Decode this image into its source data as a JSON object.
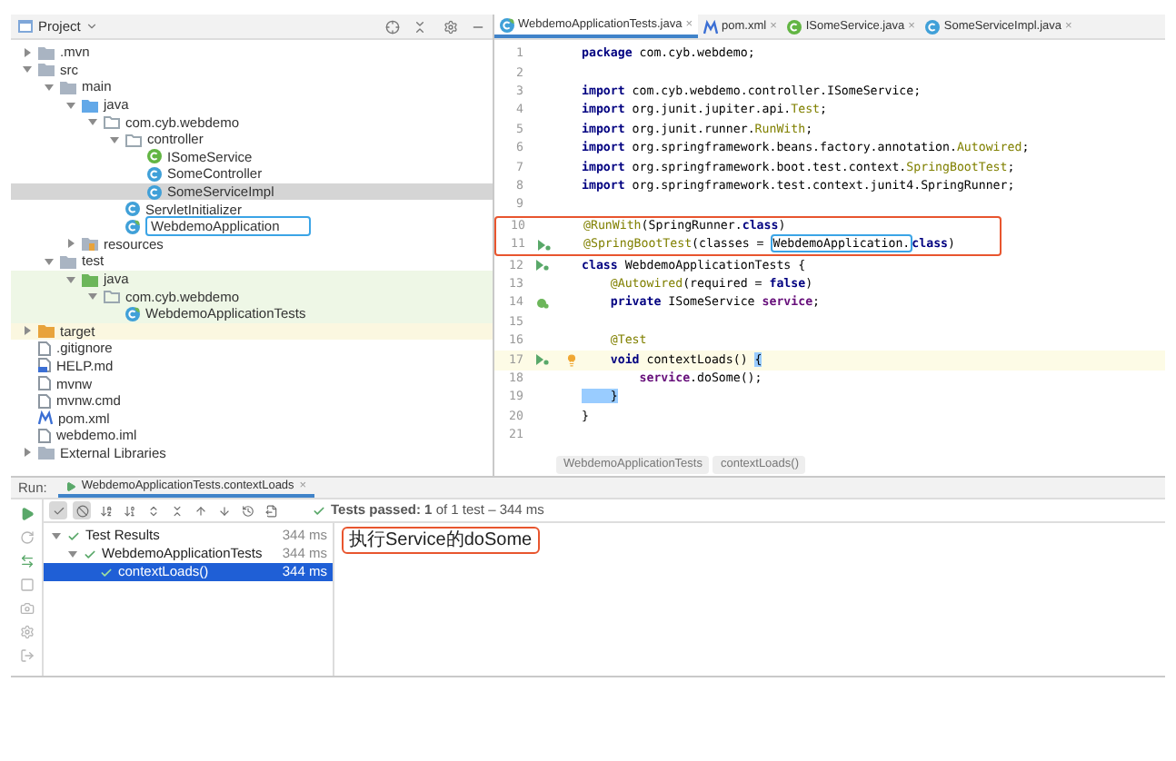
{
  "project_panel": {
    "title": "Project",
    "tree": [
      {
        "label": ".mvn",
        "kind": "folder",
        "expanded": false,
        "selected": false
      },
      {
        "label": "src",
        "kind": "folder",
        "expanded": true,
        "selected": false,
        "children": [
          {
            "label": "main",
            "kind": "folder",
            "expanded": true,
            "selected": false,
            "children": [
              {
                "label": "java",
                "kind": "folder-source",
                "expanded": true,
                "selected": false,
                "children": [
                  {
                    "label": "com.cyb.webdemo",
                    "kind": "package",
                    "expanded": true,
                    "selected": false,
                    "children": [
                      {
                        "label": "controller",
                        "kind": "package",
                        "expanded": true,
                        "selected": false,
                        "children": [
                          {
                            "label": "ISomeService",
                            "kind": "interface",
                            "selected": false
                          },
                          {
                            "label": "SomeController",
                            "kind": "class",
                            "selected": false
                          },
                          {
                            "label": "SomeServiceImpl",
                            "kind": "class",
                            "selected": true
                          }
                        ]
                      },
                      {
                        "label": "ServletInitializer",
                        "kind": "class",
                        "selected": false
                      },
                      {
                        "label": "WebdemoApplication",
                        "kind": "spring-class",
                        "selected": false,
                        "highlighted": true
                      }
                    ]
                  }
                ]
              },
              {
                "label": "resources",
                "kind": "folder-resources",
                "expanded": false,
                "selected": false
              }
            ]
          },
          {
            "label": "test",
            "kind": "folder",
            "expanded": true,
            "selected": false,
            "children": [
              {
                "label": "java",
                "kind": "folder-test",
                "expanded": true,
                "selected": false,
                "color": "#eef7e6",
                "children": [
                  {
                    "label": "com.cyb.webdemo",
                    "kind": "package",
                    "expanded": true,
                    "selected": false,
                    "color": "#eef7e6",
                    "children": [
                      {
                        "label": "WebdemoApplicationTests",
                        "kind": "spring-class",
                        "selected": false,
                        "color": "#eef7e6"
                      }
                    ]
                  }
                ]
              }
            ]
          }
        ]
      },
      {
        "label": "target",
        "kind": "folder-excluded",
        "expanded": false,
        "selected": false,
        "color": "#fbf7e0"
      },
      {
        "label": ".gitignore",
        "kind": "file",
        "selected": false
      },
      {
        "label": "HELP.md",
        "kind": "markdown",
        "selected": false
      },
      {
        "label": "mvnw",
        "kind": "file",
        "selected": false
      },
      {
        "label": "mvnw.cmd",
        "kind": "file",
        "selected": false
      },
      {
        "label": "pom.xml",
        "kind": "maven",
        "selected": false
      },
      {
        "label": "webdemo.iml",
        "kind": "file",
        "selected": false
      },
      {
        "label": "External Libraries",
        "kind": "libraries",
        "expanded": false,
        "selected": false
      }
    ]
  },
  "editor": {
    "tabs": [
      {
        "label": "WebdemoApplicationTests.java",
        "kind": "spring-class",
        "selected": true,
        "close": "×"
      },
      {
        "label": "pom.xml",
        "kind": "maven",
        "selected": false,
        "close": "×"
      },
      {
        "label": "ISomeService.java",
        "kind": "interface",
        "selected": false,
        "close": "×"
      },
      {
        "label": "SomeServiceImpl.java",
        "kind": "class",
        "selected": false,
        "close": "×"
      }
    ],
    "lines": [
      {
        "number": "1",
        "kind": "code",
        "tokens": [
          {
            "t": "package",
            "kind": "kw"
          },
          {
            "t": " com.cyb.webdemo;",
            "kind": "plain"
          }
        ]
      },
      {
        "number": "2",
        "kind": "code"
      },
      {
        "number": "3",
        "kind": "code",
        "tokens": [
          {
            "t": "import",
            "kind": "kw"
          },
          {
            "t": " com.cyb.webdemo.controller.ISomeService;",
            "kind": "plain"
          }
        ]
      },
      {
        "number": "4",
        "kind": "code",
        "tokens": [
          {
            "t": "import",
            "kind": "kw"
          },
          {
            "t": " org.junit.jupiter.api.",
            "kind": "plain"
          },
          {
            "t": "Test",
            "kind": "ann"
          },
          {
            "t": ";",
            "kind": "plain"
          }
        ]
      },
      {
        "number": "5",
        "kind": "code",
        "tokens": [
          {
            "t": "import",
            "kind": "kw"
          },
          {
            "t": " org.junit.runner.",
            "kind": "plain"
          },
          {
            "t": "RunWith",
            "kind": "ann"
          },
          {
            "t": ";",
            "kind": "plain"
          }
        ]
      },
      {
        "number": "6",
        "kind": "code",
        "tokens": [
          {
            "t": "import",
            "kind": "kw"
          },
          {
            "t": " org.springframework.beans.factory.annotation.",
            "kind": "plain"
          },
          {
            "t": "Autowired",
            "kind": "ann"
          },
          {
            "t": ";",
            "kind": "plain"
          }
        ]
      },
      {
        "number": "7",
        "kind": "code",
        "tokens": [
          {
            "t": "import",
            "kind": "kw"
          },
          {
            "t": " org.springframework.boot.test.context.",
            "kind": "plain"
          },
          {
            "t": "SpringBootTest",
            "kind": "ann"
          },
          {
            "t": ";",
            "kind": "plain"
          }
        ]
      },
      {
        "number": "8",
        "kind": "code",
        "tokens": [
          {
            "t": "import",
            "kind": "kw"
          },
          {
            "t": " org.springframework.test.context.junit4.SpringRunner;",
            "kind": "plain"
          }
        ]
      },
      {
        "number": "9",
        "kind": "code"
      },
      {
        "number": "10",
        "kind": "code",
        "boxed": true,
        "tokens": [
          {
            "t": "@RunWith",
            "kind": "ann"
          },
          {
            "t": "(SpringRunner.",
            "kind": "plain"
          },
          {
            "t": "class",
            "kind": "kw"
          },
          {
            "t": ")",
            "kind": "plain"
          }
        ]
      },
      {
        "number": "11",
        "kind": "run",
        "boxed": true,
        "tokens": [
          {
            "t": "@SpringBootTest",
            "kind": "ann"
          },
          {
            "t": "(classes = ",
            "kind": "plain"
          },
          {
            "t": "WebdemoApplication.",
            "kind": "plain",
            "boxed": true
          },
          {
            "t": "class",
            "kind": "kw"
          },
          {
            "t": ")",
            "kind": "plain"
          }
        ]
      },
      {
        "number": "12",
        "kind": "run",
        "tokens": [
          {
            "t": "class",
            "kind": "kw"
          },
          {
            "t": " WebdemoApplicationTests {",
            "kind": "plain"
          }
        ]
      },
      {
        "number": "13",
        "kind": "code",
        "tokens": [
          {
            "t": "    @Autowired",
            "kind": "ann"
          },
          {
            "t": "(required = ",
            "kind": "plain"
          },
          {
            "t": "false",
            "kind": "kw"
          },
          {
            "t": ")",
            "kind": "plain"
          }
        ]
      },
      {
        "number": "14",
        "kind": "bean",
        "tokens": [
          {
            "t": "    private",
            "kind": "kw"
          },
          {
            "t": " ISomeService ",
            "kind": "plain"
          },
          {
            "t": "service",
            "kind": "field"
          },
          {
            "t": ";",
            "kind": "plain"
          }
        ]
      },
      {
        "number": "15",
        "kind": "code"
      },
      {
        "number": "16",
        "kind": "code",
        "tokens": [
          {
            "t": "    @Test",
            "kind": "ann"
          }
        ]
      },
      {
        "number": "17",
        "kind": "run",
        "current": true,
        "bulb": true,
        "tokens": [
          {
            "t": "    void",
            "kind": "kw"
          },
          {
            "t": " contextLoads() ",
            "kind": "plain"
          },
          {
            "t": "{",
            "kind": "brace"
          }
        ]
      },
      {
        "number": "18",
        "kind": "code",
        "tokens": [
          {
            "t": "        service",
            "kind": "field"
          },
          {
            "t": ".doSome();",
            "kind": "plain"
          }
        ]
      },
      {
        "number": "19",
        "kind": "code",
        "tokens": [
          {
            "t": "    }",
            "kind": "brace"
          }
        ]
      },
      {
        "number": "20",
        "kind": "code",
        "tokens": [
          {
            "t": "}",
            "kind": "plain"
          }
        ]
      },
      {
        "number": "21",
        "kind": "code"
      }
    ],
    "breadcrumbs": [
      "WebdemoApplicationTests",
      "contextLoads()"
    ]
  },
  "run_panel": {
    "label": "Run:",
    "tab": {
      "label": "WebdemoApplicationTests.contextLoads",
      "close": "×"
    },
    "side_tools": [
      {
        "kind": "run",
        "disabled": false
      },
      {
        "kind": "rerun-failed",
        "disabled": true
      },
      {
        "kind": "toggle",
        "disabled": false
      },
      {
        "kind": "stop",
        "disabled": true
      },
      {
        "kind": "snapshot",
        "disabled": true
      },
      {
        "kind": "settings",
        "disabled": true
      },
      {
        "kind": "exit",
        "disabled": true
      }
    ],
    "toolbar": [
      {
        "kind": "passed",
        "on": true
      },
      {
        "kind": "ignored",
        "on": true
      },
      {
        "kind": "sort-alpha",
        "on": false
      },
      {
        "kind": "sort-duration",
        "on": false
      },
      {
        "kind": "expand",
        "on": false
      },
      {
        "kind": "collapse",
        "on": false
      },
      {
        "kind": "up",
        "on": false
      },
      {
        "kind": "down",
        "on": false
      },
      {
        "kind": "history",
        "on": false
      },
      {
        "kind": "export",
        "on": false
      }
    ],
    "status": "**Tests passed: 1** of 1 test – 344 ms",
    "results": [
      {
        "label": "Test Results",
        "time": "344 ms",
        "selected": false,
        "children": [
          {
            "label": "WebdemoApplicationTests",
            "time": "344 ms",
            "selected": false,
            "children": [
              {
                "label": "contextLoads()",
                "time": "344 ms",
                "selected": true
              }
            ]
          }
        ]
      }
    ],
    "console": [
      {
        "text": "执行Service的doSome",
        "boxed": true
      }
    ]
  }
}
